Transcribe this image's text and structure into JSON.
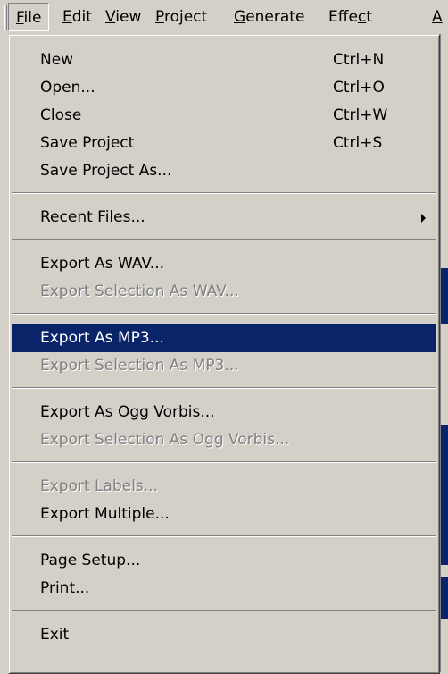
{
  "menubar": {
    "items": [
      {
        "label": "File",
        "mnemonic": "F",
        "rest": "ile"
      },
      {
        "label": "Edit",
        "mnemonic": "E",
        "rest": "dit"
      },
      {
        "label": "View",
        "mnemonic": "V",
        "rest": "iew"
      },
      {
        "label": "Project",
        "mnemonic": "P",
        "rest": "roject"
      },
      {
        "label": "Generate",
        "mnemonic": "G",
        "rest": "enerate"
      },
      {
        "label": "Effect",
        "pre": "Effe",
        "mnemonic": "c",
        "rest": "t"
      },
      {
        "label": "A",
        "mnemonic": "A",
        "rest": ""
      }
    ]
  },
  "file_menu": {
    "new": {
      "label": "New",
      "shortcut": "Ctrl+N"
    },
    "open": {
      "label": "Open...",
      "shortcut": "Ctrl+O"
    },
    "close": {
      "label": "Close",
      "shortcut": "Ctrl+W"
    },
    "save_project": {
      "label": "Save Project",
      "shortcut": "Ctrl+S"
    },
    "save_project_as": {
      "label": "Save Project As..."
    },
    "recent_files": {
      "label": "Recent Files..."
    },
    "export_wav": {
      "label": "Export As WAV..."
    },
    "export_sel_wav": {
      "label": "Export Selection As WAV..."
    },
    "export_mp3": {
      "label": "Export As MP3..."
    },
    "export_sel_mp3": {
      "label": "Export Selection As MP3..."
    },
    "export_ogg": {
      "label": "Export As Ogg Vorbis..."
    },
    "export_sel_ogg": {
      "label": "Export Selection As Ogg Vorbis..."
    },
    "export_labels": {
      "label": "Export Labels..."
    },
    "export_multiple": {
      "label": "Export Multiple..."
    },
    "page_setup": {
      "label": "Page Setup..."
    },
    "print": {
      "label": "Print..."
    },
    "exit": {
      "label": "Exit"
    }
  },
  "colors": {
    "menu_bg": "#d4d0c8",
    "highlight": "#0a246a",
    "disabled_text": "#808080"
  }
}
